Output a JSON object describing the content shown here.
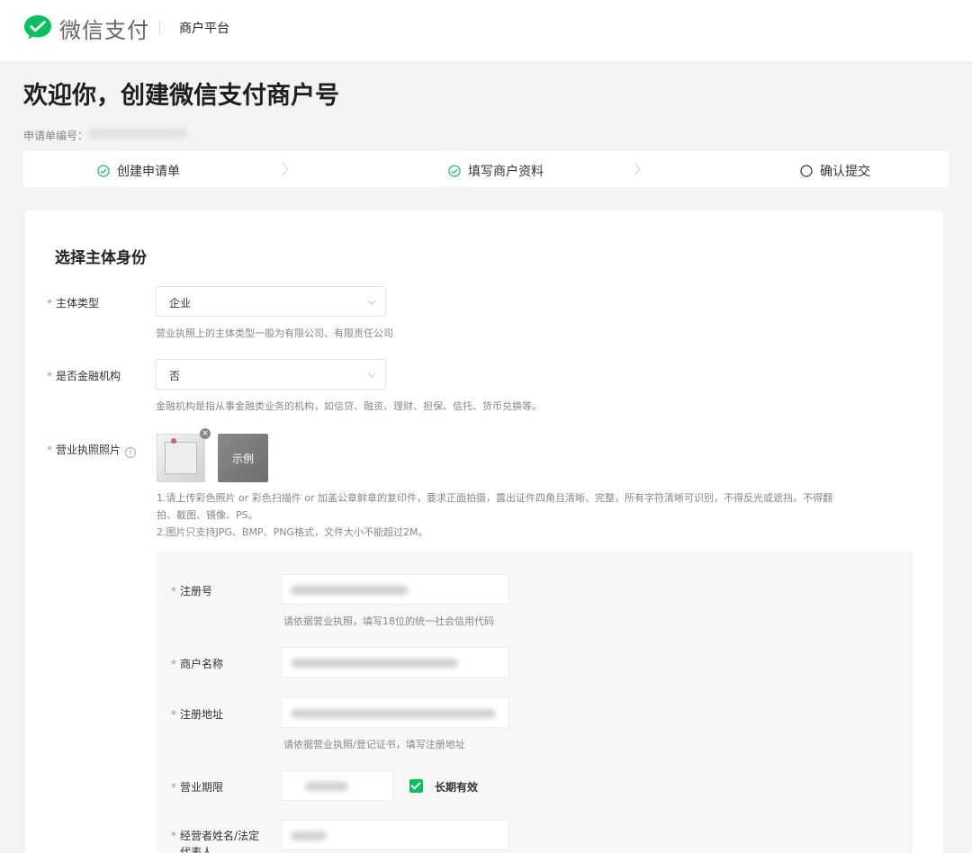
{
  "header": {
    "brand": "微信支付",
    "platform": "商户平台",
    "logo_icon": "wechat-bubble-icon",
    "brand_color": "#07c160"
  },
  "page": {
    "title": "欢迎你，创建微信支付商户号",
    "application_no_label": "申请单编号："
  },
  "steps": [
    {
      "label": "创建申请单",
      "status": "done"
    },
    {
      "label": "填写商户资料",
      "status": "done"
    },
    {
      "label": "确认提交",
      "status": "pending"
    }
  ],
  "section": {
    "title": "选择主体身份"
  },
  "form": {
    "subject_type": {
      "label": "主体类型",
      "value": "企业",
      "hint": "营业执照上的主体类型一般为有限公司、有限责任公司"
    },
    "financial": {
      "label": "是否金融机构",
      "value": "否",
      "hint": "金融机构是指从事金融类业务的机构，如信贷、融资、理财、担保、信托、货币兑换等。"
    },
    "license_photo": {
      "label": "营业执照照片",
      "example_label": "示例",
      "note_line1": "1.请上传彩色照片 or 彩色扫描件 or 加盖公章鲜章的复印件，要求正面拍摄，露出证件四角且清晰、完整，所有字符清晰可识别，不得反光或遮挡。不得翻",
      "note_line2": "拍、截图、镜像、PS。",
      "note_line3": "2.图片只支持JPG、BMP、PNG格式，文件大小不能超过2M。"
    },
    "registration_no": {
      "label": "注册号",
      "hint": "请依据营业执照，填写18位的统一社会信用代码"
    },
    "merchant_name": {
      "label": "商户名称"
    },
    "registered_address": {
      "label": "注册地址",
      "hint": "请依据营业执照/登记证书，填写注册地址"
    },
    "business_term": {
      "label": "营业期限",
      "long_term_label": "长期有效",
      "long_term_checked": true
    },
    "operator_name": {
      "label_line1": "经营者姓名/法定",
      "label_line2": "代表人"
    }
  }
}
